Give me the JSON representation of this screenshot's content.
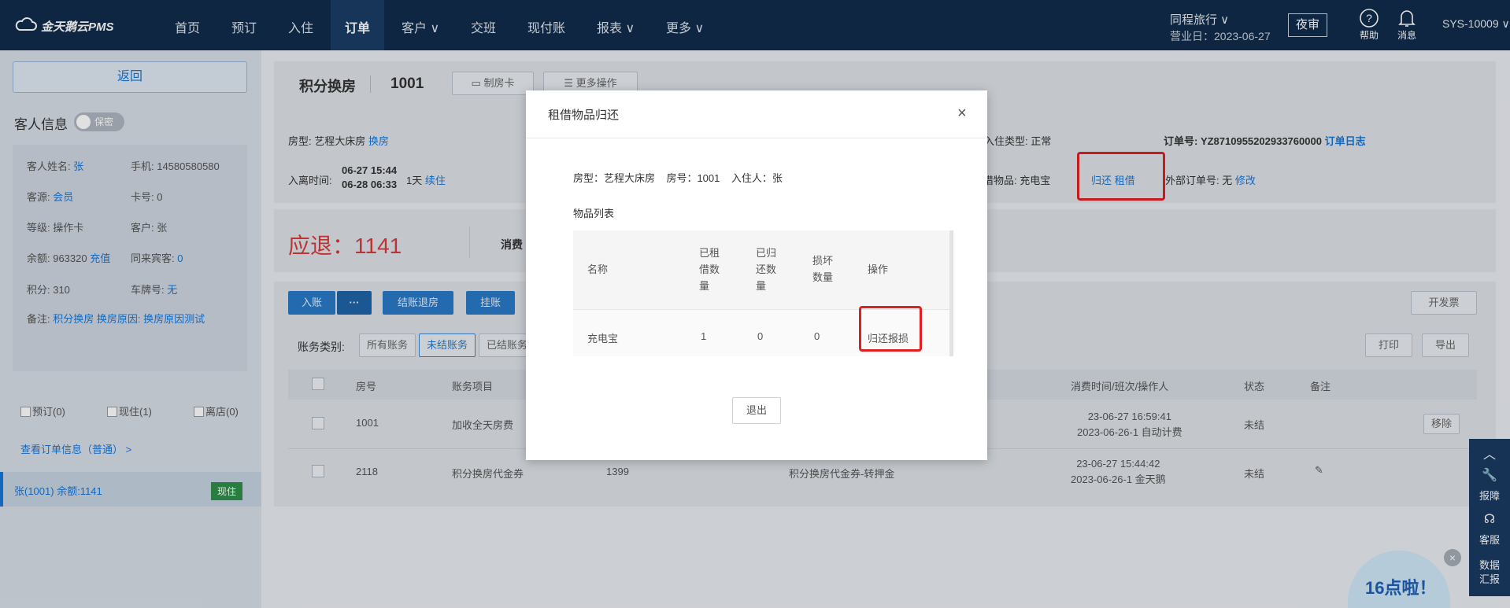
{
  "header": {
    "logo": "金天鹅云PMS",
    "nav": [
      "首页",
      "预订",
      "入住",
      "订单",
      "客户 ∨",
      "交班",
      "现付账",
      "报表 ∨",
      "更多 ∨"
    ],
    "hotel": "同程旅行 ∨",
    "biz_date": "营业日：2023-06-27",
    "night_audit": "夜审",
    "help": "帮助",
    "messages": "消息",
    "user": "SYS-10009 ∨"
  },
  "sidebar": {
    "back": "返回",
    "guest_title": "客人信息",
    "privacy": "保密",
    "info": {
      "name_k": "客人姓名:",
      "name_v": "张",
      "phone": "手机: 14580580580",
      "source_k": "客源:",
      "source_v": "会员",
      "card": "卡号: 0",
      "level": "等级: 操作卡",
      "customer": "客户: 张",
      "balance": "余额: 963320",
      "recharge": "充值",
      "companions_k": "同来宾客:",
      "companions_v": "0",
      "points": "积分: 310",
      "plate_k": "车牌号:",
      "plate_v": "无",
      "remark_k": "备注:",
      "remark_v": "积分换房 换房原因: 换房原因测试"
    },
    "tabs": [
      "预订(0)",
      "现住(1)",
      "离店(0)"
    ],
    "view_order": "查看订单信息（普通） >",
    "room_entry": "张(1001)  余额:1141",
    "room_status": "现住"
  },
  "order": {
    "type": "积分换房",
    "room": "1001",
    "make_card": "制房卡",
    "more_ops": "更多操作",
    "room_type_k": "房型:",
    "room_type_v": "艺程大床房",
    "change_room": "换房",
    "checkin_k": "入离时间:",
    "checkin_1": "06-27 15:44",
    "checkin_2": "06-28 06:33",
    "nights": "1天",
    "extend": "续住",
    "checkin_type": "入住类型: 正常",
    "order_no": "订单号: YZ8710955202933760000",
    "order_log": "订单日志",
    "rental_k": "租借物品: 充电宝",
    "return_rental": "归还 租借",
    "ext_order_k": "外部订单号: 无",
    "ext_edit": "修改",
    "refund": "应退：1141",
    "consume": "消费"
  },
  "bill": {
    "post": "入账",
    "more": "···",
    "checkout": "结账退房",
    "hang": "挂账",
    "invoice": "开发票",
    "category_k": "账务类别:",
    "filters": [
      "所有账务",
      "未结账务",
      "已结账务"
    ],
    "print": "打印",
    "export": "导出",
    "columns": [
      "房号",
      "账务项目",
      "消费时间/班次/操作人",
      "状态",
      "备注"
    ],
    "rows": [
      {
        "room": "1001",
        "item": "加收全天房费",
        "amount": "",
        "desc": "",
        "time": "23-06-27 16:59:41",
        "shift": "2023-06-26-1 自动计费",
        "status": "未结",
        "action": "移除"
      },
      {
        "room": "2118",
        "item": "积分换房代金券",
        "amount": "1399",
        "desc": "积分换房代金券-转押金",
        "time": "23-06-27 15:44:42",
        "shift": "2023-06-26-1 金天鹅",
        "status": "未结",
        "action": ""
      }
    ]
  },
  "modal": {
    "title": "租借物品归还",
    "close": "×",
    "info": "房型：艺程大床房    房号：1001    入住人：张",
    "list_label": "物品列表",
    "headers": [
      "名称",
      "已租借数量",
      "已归还数量",
      "损坏数量",
      "操作"
    ],
    "row": {
      "name": "充电宝",
      "rented": "1",
      "returned": "0",
      "damaged": "0",
      "action": "归还报损"
    },
    "exit": "退出"
  },
  "float": {
    "report": "报障",
    "service": "客服",
    "data": "数据汇报",
    "promo": "16点啦！"
  }
}
